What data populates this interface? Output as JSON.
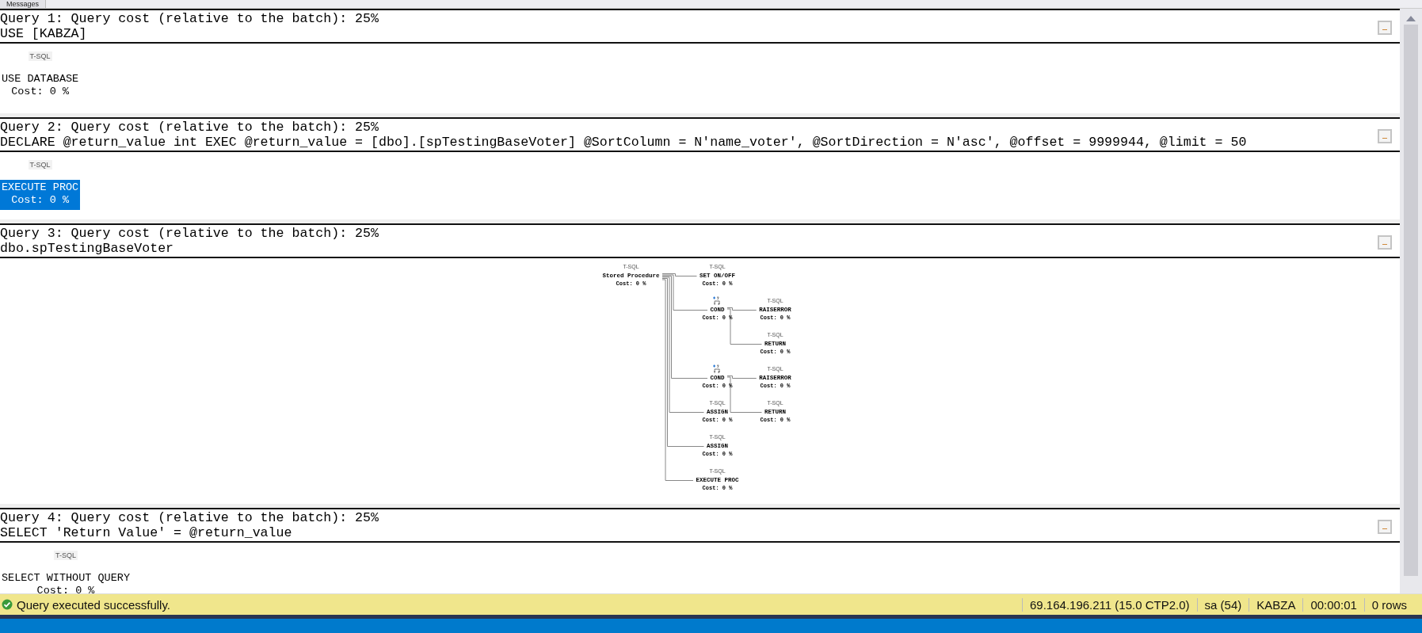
{
  "tab_strip": {
    "tabs": [
      {
        "label": "Messages",
        "selected": false
      }
    ]
  },
  "queries": [
    {
      "header": "Query 1: Query cost (relative to the batch): 25%",
      "statement": "USE [KABZA]",
      "plan": {
        "kind": "single",
        "nodes": [
          {
            "kind": "tsql",
            "badge": "T-SQL",
            "name": "USE DATABASE",
            "cost": "Cost: 0 %",
            "selected": false
          }
        ]
      }
    },
    {
      "header": "Query 2: Query cost (relative to the batch): 25%",
      "statement": "DECLARE @return_value int EXEC @return_value = [dbo].[spTestingBaseVoter] @SortColumn = N'name_voter', @SortDirection = N'asc', @offset = 9999944, @limit = 50",
      "plan": {
        "kind": "single",
        "nodes": [
          {
            "kind": "tsql",
            "badge": "T-SQL",
            "name": "EXECUTE PROC",
            "cost": "Cost: 0 %",
            "selected": true
          }
        ]
      }
    },
    {
      "header": "Query 3: Query cost (relative to the batch): 25%",
      "statement": "dbo.spTestingBaseVoter",
      "plan": {
        "kind": "tree",
        "root": {
          "kind": "tsql",
          "badge": "T-SQL",
          "name": "Stored Procedure",
          "cost": "Cost: 0 %",
          "selected": false,
          "children": [
            {
              "kind": "tsql",
              "badge": "T-SQL",
              "name": "SET ON/OFF",
              "cost": "Cost: 0 %",
              "selected": false
            },
            {
              "kind": "cond",
              "name": "COND",
              "cost": "Cost: 0 %",
              "selected": false,
              "children": [
                {
                  "kind": "tsql",
                  "badge": "T-SQL",
                  "name": "RAISERROR",
                  "cost": "Cost: 0 %",
                  "selected": false
                },
                {
                  "kind": "tsql",
                  "badge": "T-SQL",
                  "name": "RETURN",
                  "cost": "Cost: 0 %",
                  "selected": false
                }
              ]
            },
            {
              "kind": "cond",
              "name": "COND",
              "cost": "Cost: 0 %",
              "selected": false,
              "children": [
                {
                  "kind": "tsql",
                  "badge": "T-SQL",
                  "name": "RAISERROR",
                  "cost": "Cost: 0 %",
                  "selected": false
                },
                {
                  "kind": "tsql",
                  "badge": "T-SQL",
                  "name": "RETURN",
                  "cost": "Cost: 0 %",
                  "selected": false
                }
              ]
            },
            {
              "kind": "tsql",
              "badge": "T-SQL",
              "name": "ASSIGN",
              "cost": "Cost: 0 %",
              "selected": false
            },
            {
              "kind": "tsql",
              "badge": "T-SQL",
              "name": "ASSIGN",
              "cost": "Cost: 0 %",
              "selected": false
            },
            {
              "kind": "tsql",
              "badge": "T-SQL",
              "name": "EXECUTE PROC",
              "cost": "Cost: 0 %",
              "selected": false
            }
          ]
        }
      }
    },
    {
      "header": "Query 4: Query cost (relative to the batch): 25%",
      "statement": "SELECT 'Return Value' = @return_value",
      "plan": {
        "kind": "single",
        "nodes": [
          {
            "kind": "tsql",
            "badge": "T-SQL",
            "name": "SELECT WITHOUT QUERY",
            "cost": "Cost: 0 %",
            "selected": false
          }
        ]
      }
    }
  ],
  "status_bar": {
    "message": "Query executed successfully.",
    "segments": [
      "69.164.196.211 (15.0 CTP2.0)",
      "sa (54)",
      "KABZA",
      "00:00:01",
      "0 rows"
    ]
  }
}
